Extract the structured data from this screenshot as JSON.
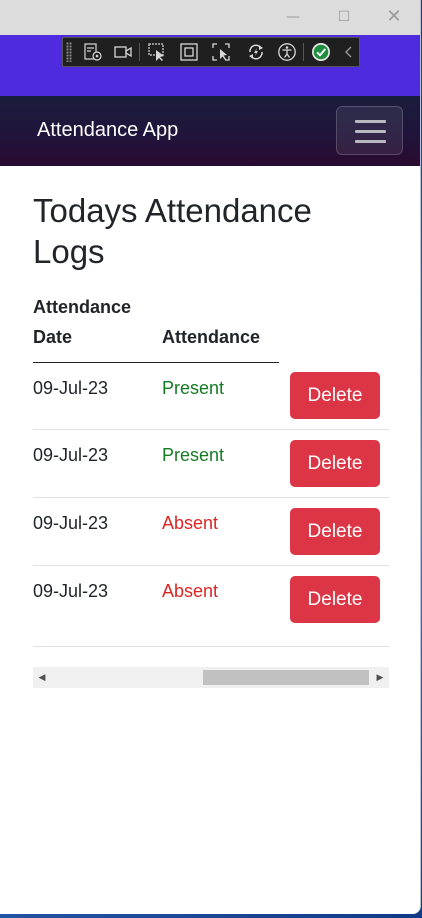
{
  "window": {
    "controls": {
      "minimize": "—",
      "maximize": "☐",
      "close": "✕"
    }
  },
  "devtools_toolbar": {
    "icons": [
      "live-visual-tree-icon",
      "video-record-icon",
      "select-element-icon",
      "display-layout-adorners-icon",
      "track-focus-icon",
      "hot-reload-icon",
      "accessibility-checker-icon",
      "checkmark-icon",
      "collapse-chevron-icon"
    ],
    "accent_color": "#1e8e3e"
  },
  "navbar": {
    "brand": "Attendance App",
    "toggler_icon": "hamburger-menu-icon"
  },
  "page": {
    "title": "Todays Attendance Logs"
  },
  "table": {
    "headers": [
      "Attendance Date",
      "Attendance"
    ],
    "delete_label": "Delete",
    "rows": [
      {
        "date": "09-Jul-23",
        "status": "Present"
      },
      {
        "date": "09-Jul-23",
        "status": "Present"
      },
      {
        "date": "09-Jul-23",
        "status": "Absent"
      },
      {
        "date": "09-Jul-23",
        "status": "Absent"
      }
    ]
  },
  "colors": {
    "present": "#167a24",
    "absent": "#dc2626",
    "delete_button": "#dc3545",
    "band": "#4f2be0"
  }
}
